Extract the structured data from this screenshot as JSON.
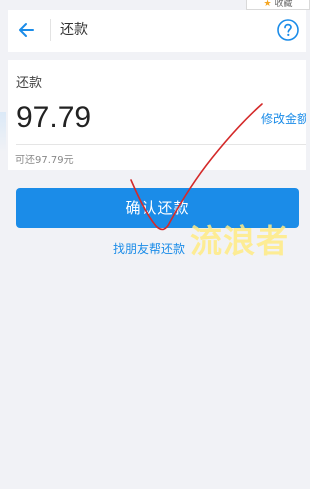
{
  "favorites_badge": {
    "label": "收藏",
    "icon": "star-icon",
    "color": "#f5a623"
  },
  "header": {
    "back_icon": "back-arrow-icon",
    "title": "还款",
    "help_icon": "help-icon"
  },
  "repay": {
    "label": "还款",
    "amount": "97.79",
    "modify_label": "修改金额",
    "available_text": "可还97.79元"
  },
  "actions": {
    "confirm_label": "确认还款",
    "friend_label": "找朋友帮还款"
  },
  "watermark": {
    "text": "流浪者"
  },
  "colors": {
    "accent": "#1b8ce8",
    "background": "#f1f2f6",
    "annotation": "#d42a2a"
  }
}
